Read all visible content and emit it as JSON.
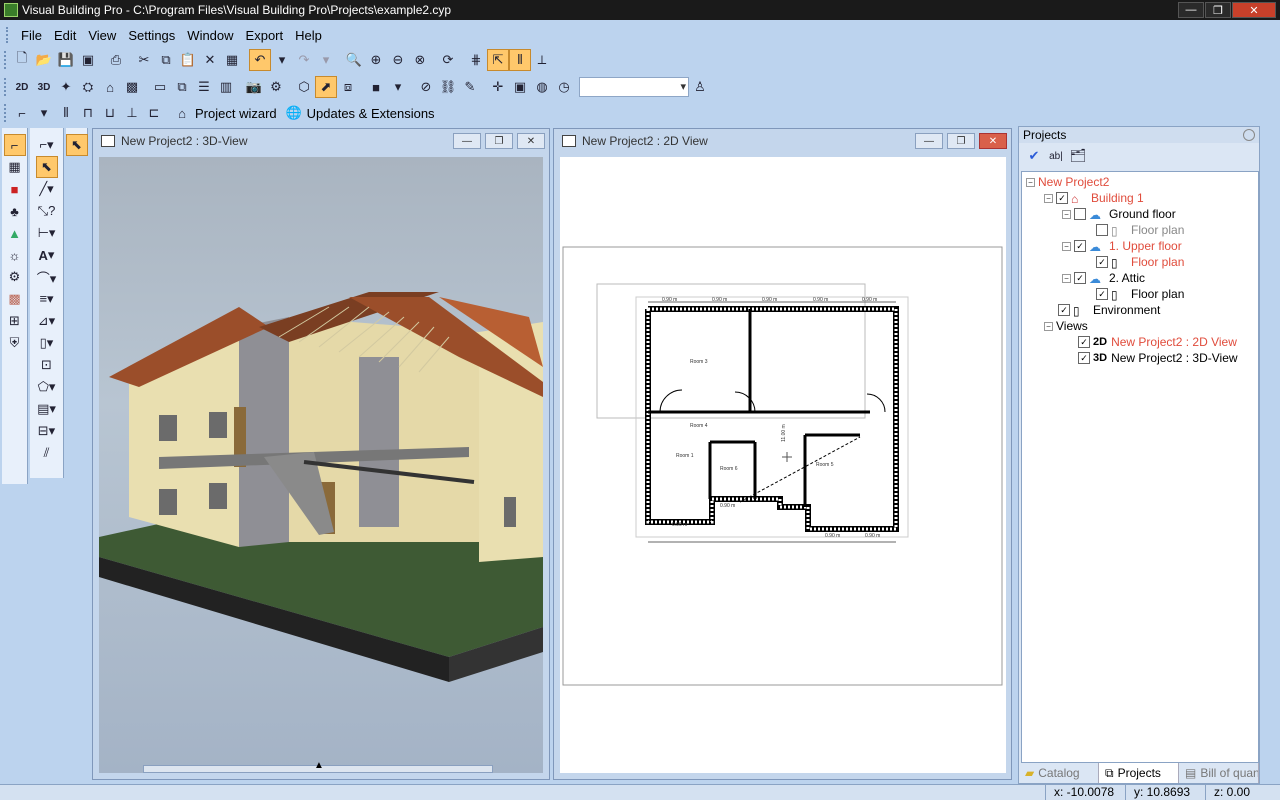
{
  "titlebar": {
    "title": "Visual Building Pro - C:\\Program Files\\Visual Building Pro\\Projects\\example2.cyp"
  },
  "menu": [
    "File",
    "Edit",
    "View",
    "Settings",
    "Window",
    "Export",
    "Help"
  ],
  "toolbar3": {
    "project_wizard": "Project wizard",
    "updates": "Updates & Extensions"
  },
  "view3d": {
    "title": "New Project2 : 3D-View"
  },
  "view2d": {
    "title": "New Project2 : 2D View",
    "rooms": [
      "Room 3",
      "Room 4",
      "Room 1",
      "Room 6",
      "Room 5"
    ],
    "dim_label": "0.90 m",
    "dim_vertical": "11.00 m"
  },
  "projects": {
    "title": "Projects",
    "tree": {
      "project": "New Project2",
      "building": "Building 1",
      "ground_floor": "Ground floor",
      "floor_plan": "Floor plan",
      "upper_floor": "1. Upper floor",
      "attic": "2. Attic",
      "environment": "Environment",
      "views": "Views",
      "view_2d_badge": "2D",
      "view_2d": "New Project2 : 2D View",
      "view_3d_badge": "3D",
      "view_3d": "New Project2 : 3D-View"
    },
    "tabs": [
      "Catalog",
      "Projects",
      "Bill of quantiti..."
    ]
  },
  "status": {
    "x": "x: -10.0078",
    "y": "y: 10.8693",
    "z": "z: 0.00"
  }
}
